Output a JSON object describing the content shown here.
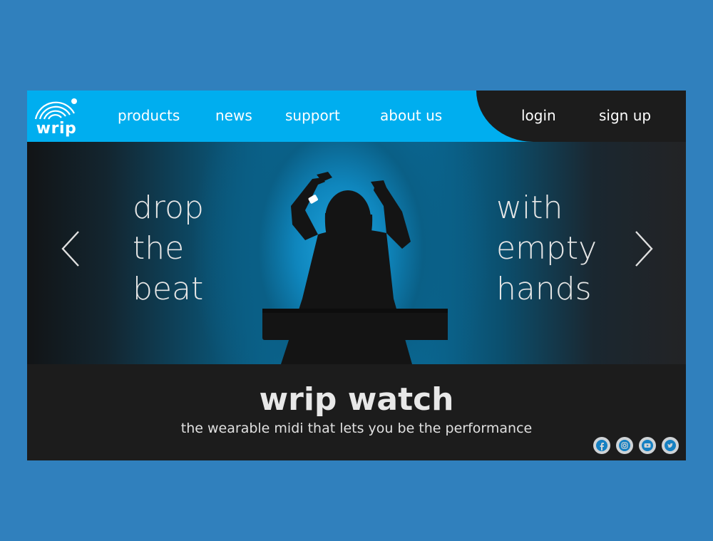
{
  "brand": {
    "logo_text": "wrip"
  },
  "nav": {
    "links": [
      "products",
      "news",
      "support",
      "about us"
    ],
    "login": "login",
    "signup": "sign up"
  },
  "hero": {
    "left_text": "drop\nthe\nbeat",
    "right_text": "with\nempty\nhands"
  },
  "product": {
    "title": "wrip watch",
    "tagline": "the wearable midi that lets you be the performance"
  },
  "socials": [
    "facebook",
    "instagram",
    "youtube",
    "twitter"
  ],
  "colors": {
    "page_bg": "#3080bd",
    "nav_bg": "#00aeef",
    "dark": "#1c1c1c",
    "text": "#e8e8e8",
    "social_icon": "#1580c2"
  }
}
